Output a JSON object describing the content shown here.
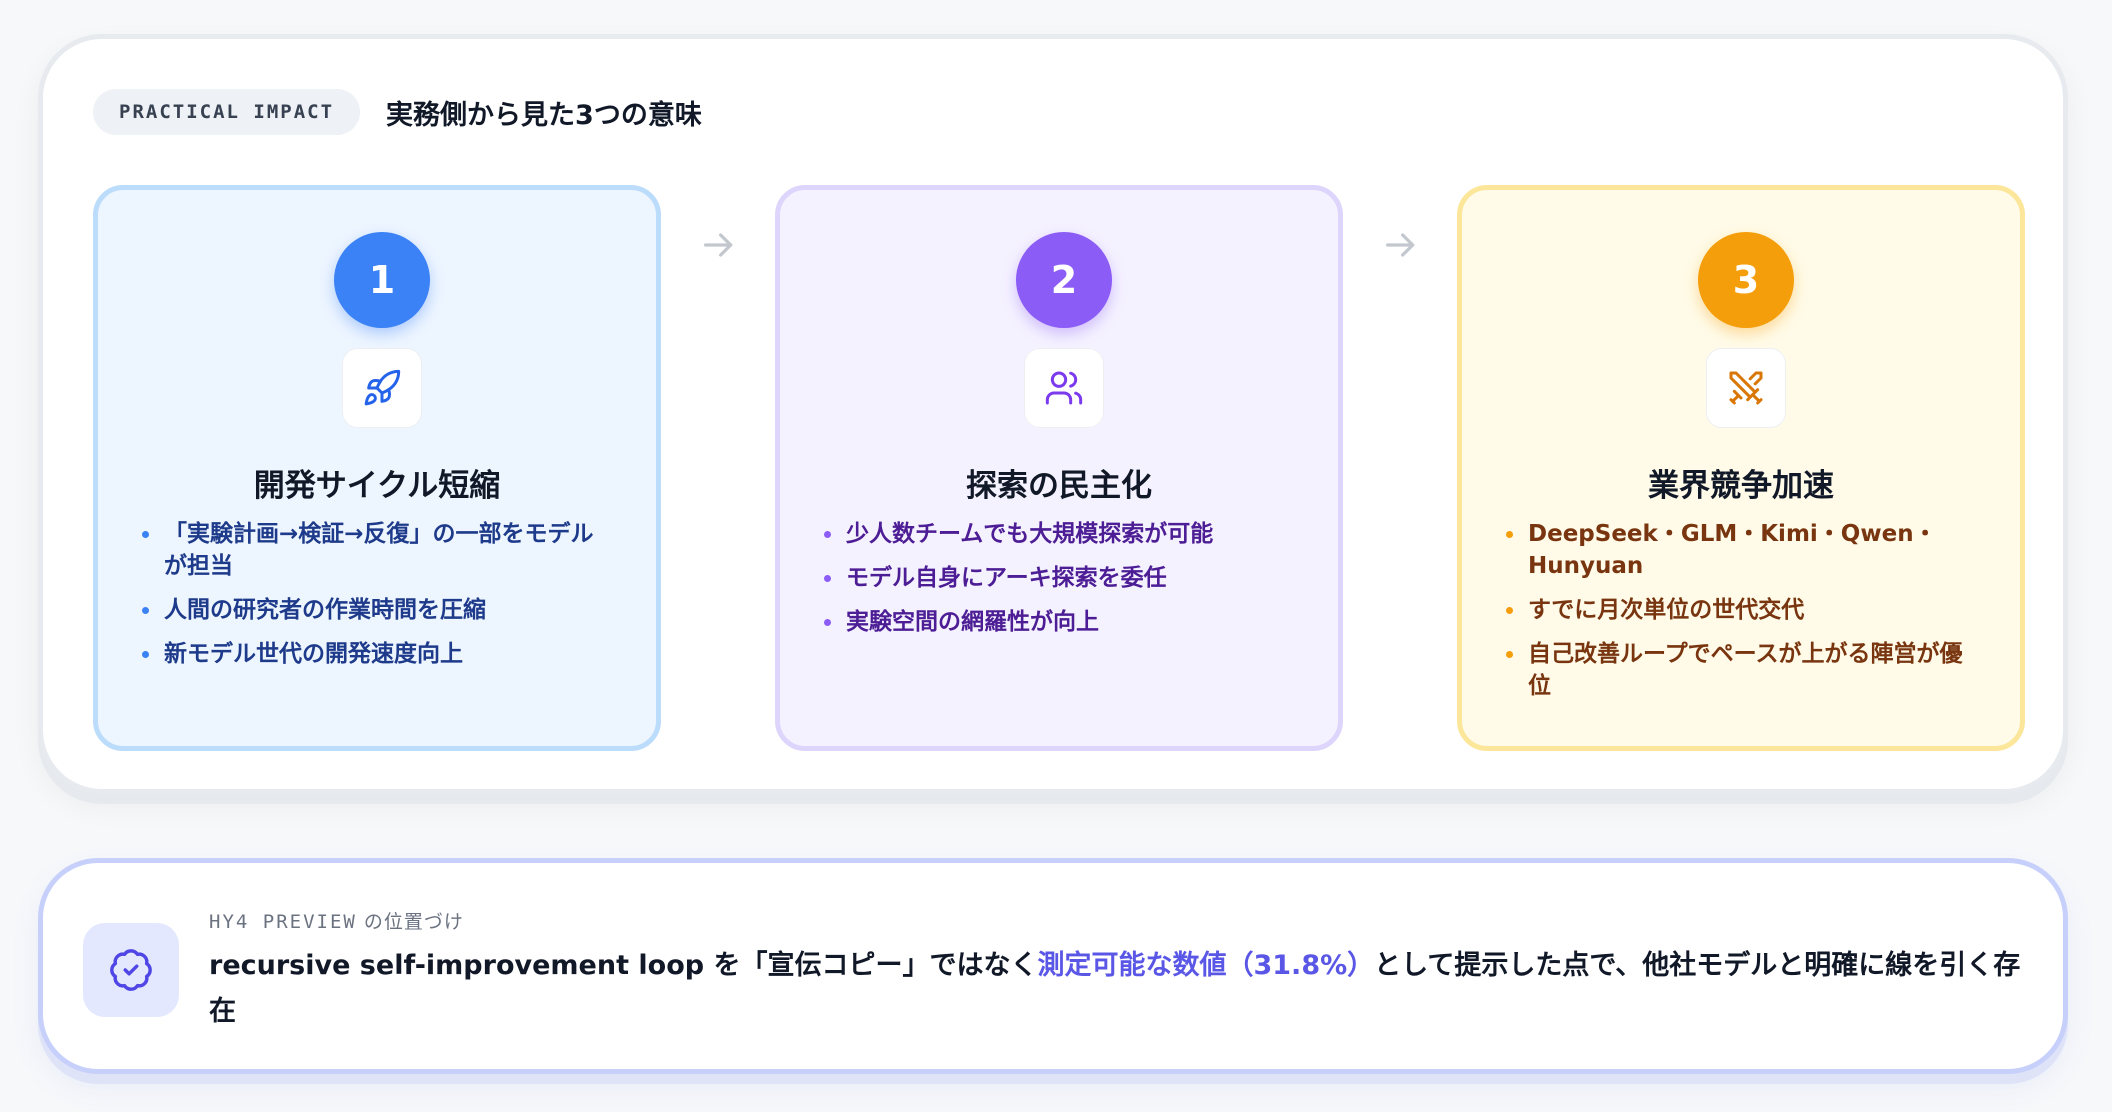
{
  "header": {
    "tag": "PRACTICAL IMPACT",
    "title": "実務側から見た3つの意味"
  },
  "steps": [
    {
      "number": "1",
      "icon": "rocket-icon",
      "title": "開発サイクル短縮",
      "bullets": [
        "「実験計画→検証→反復」の一部をモデルが担当",
        "人間の研究者の作業時間を圧縮",
        "新モデル世代の開発速度向上"
      ]
    },
    {
      "number": "2",
      "icon": "users-icon",
      "title": "探索の民主化",
      "bullets": [
        "少人数チームでも大規模探索が可能",
        "モデル自身にアーキ探索を委任",
        "実験空間の網羅性が向上"
      ]
    },
    {
      "number": "3",
      "icon": "crossed-swords-icon",
      "title": "業界競争加速",
      "bullets": [
        "DeepSeek・GLM・Kimi・Qwen・Hunyuan",
        "すでに月次単位の世代交代",
        "自己改善ループでペースが上がる陣営が優位"
      ]
    }
  ],
  "note": {
    "label_mono": "HY4 PREVIEW",
    "label_rest": " の位置づけ",
    "icon": "badge-check-icon",
    "text_before": "recursive self-improvement loop を「宣伝コピー」ではなく",
    "text_highlight": "測定可能な数値（31.8%）",
    "text_after": "として提示した点で、他社モデルと明確に線を引く存在"
  },
  "colors": {
    "step1": "#3b82f6",
    "step2": "#8b5cf6",
    "step3": "#f59e0b",
    "highlight": "#5b57e6"
  }
}
